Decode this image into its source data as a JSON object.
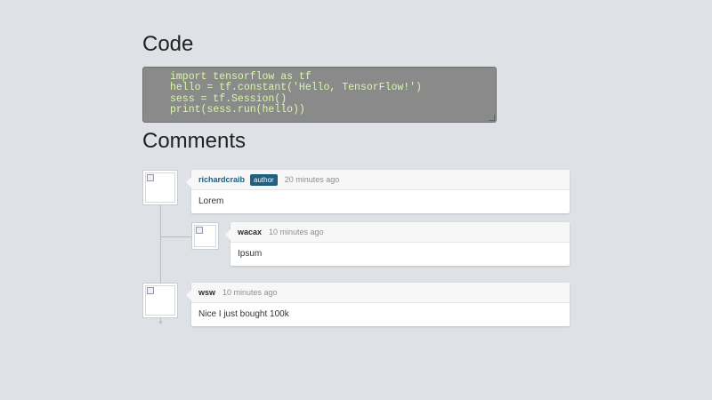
{
  "headings": {
    "code": "Code",
    "comments": "Comments"
  },
  "code": {
    "lines": [
      "import tensorflow as tf",
      "hello = tf.constant('Hello, TensorFlow!')",
      "sess = tf.Session()",
      "print(sess.run(hello))"
    ]
  },
  "comments": [
    {
      "user": "richardcraib",
      "badge": "author",
      "time": "20 minutes ago",
      "text": "Lorem",
      "replies": [
        {
          "user": "wacax",
          "time": "10 minutes ago",
          "text": "Ipsum"
        }
      ]
    },
    {
      "user": "wsw",
      "time": "10 minutes ago",
      "text": "Nice I just bought 100k"
    }
  ],
  "colors": {
    "background": "#dee2e6",
    "code_bg": "#8a8a8a",
    "code_text": "#d8f8a8",
    "accent": "#1f5f7f"
  }
}
